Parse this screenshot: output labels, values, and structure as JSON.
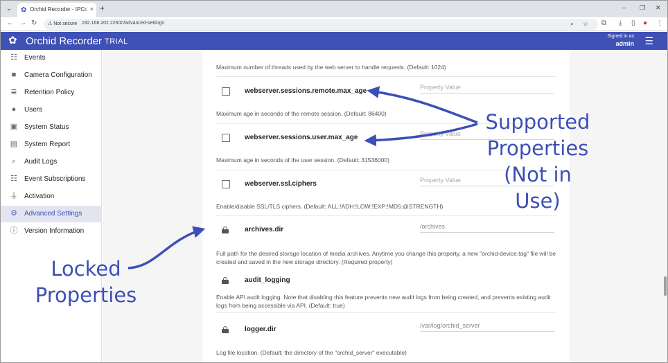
{
  "browser": {
    "tab_title": "Orchid Recorder - IPConfigure",
    "tab_close": "×",
    "new_tab": "+",
    "security": "Not secure",
    "url": "192.168.202.226/#!/advanced-settings"
  },
  "app": {
    "title": "Orchid Recorder",
    "badge": "TRIAL",
    "signed_in_as": "Signed in as",
    "user": "admin"
  },
  "sidebar": {
    "items": [
      {
        "label": "Events",
        "icon": "events-icon"
      },
      {
        "label": "Camera Configuration",
        "icon": "camera-icon"
      },
      {
        "label": "Retention Policy",
        "icon": "database-icon"
      },
      {
        "label": "Users",
        "icon": "user-icon"
      },
      {
        "label": "System Status",
        "icon": "status-icon"
      },
      {
        "label": "System Report",
        "icon": "report-icon"
      },
      {
        "label": "Audit Logs",
        "icon": "audit-icon"
      },
      {
        "label": "Event Subscriptions",
        "icon": "subscriptions-icon"
      },
      {
        "label": "Activation",
        "icon": "plug-icon"
      },
      {
        "label": "Advanced Settings",
        "icon": "gears-icon",
        "active": true
      },
      {
        "label": "Version Information",
        "icon": "info-icon"
      }
    ]
  },
  "settings": {
    "top_description": "Maximum number of threads used by the web server to handle requests. (Default: 1024)",
    "properties": [
      {
        "name": "webserver.sessions.remote.max_age",
        "value": "",
        "placeholder": "Property Value",
        "locked": false,
        "description": "Maximum age in seconds of the remote session. (Default: 86400)"
      },
      {
        "name": "webserver.sessions.user.max_age",
        "value": "",
        "placeholder": "Property Value",
        "locked": false,
        "description": "Maximum age in seconds of the user session. (Default: 31536000)"
      },
      {
        "name": "webserver.ssl.ciphers",
        "value": "",
        "placeholder": "Property Value",
        "locked": false,
        "description": "Enable/disable SSL/TLS ciphers. (Default: ALL:!ADH:!LOW:!EXP:!MD5:@STRENGTH)"
      },
      {
        "name": "archives.dir",
        "value": "/orchives",
        "placeholder": "",
        "locked": true,
        "description": "Full path for the desired storage location of media archives. Anytime you change this property, a new \"orchid-device.tag\" file will be created and saved in the new storage directory. (Required property)"
      },
      {
        "name": "audit_logging",
        "value": "",
        "placeholder": "",
        "locked": true,
        "description": "Enable API audit logging. Note that disabling this feature prevents new audit logs from being created, and prevents existing audit logs from being accessible via API. (Default: true)"
      },
      {
        "name": "logger.dir",
        "value": "/var/log/orchid_server",
        "placeholder": "",
        "locked": true,
        "description": "Log file location. (Default: the directory of the \"orchid_server\" executable)"
      }
    ]
  },
  "annotations": {
    "supported_lines": [
      "Supported",
      "Properties",
      "(Not in",
      "Use)"
    ],
    "locked_lines": [
      "Locked",
      "Properties"
    ],
    "color": "#3d4fb5"
  },
  "colors": {
    "header": "#3f51b5",
    "sidebar_active": "#e2e4f0"
  }
}
